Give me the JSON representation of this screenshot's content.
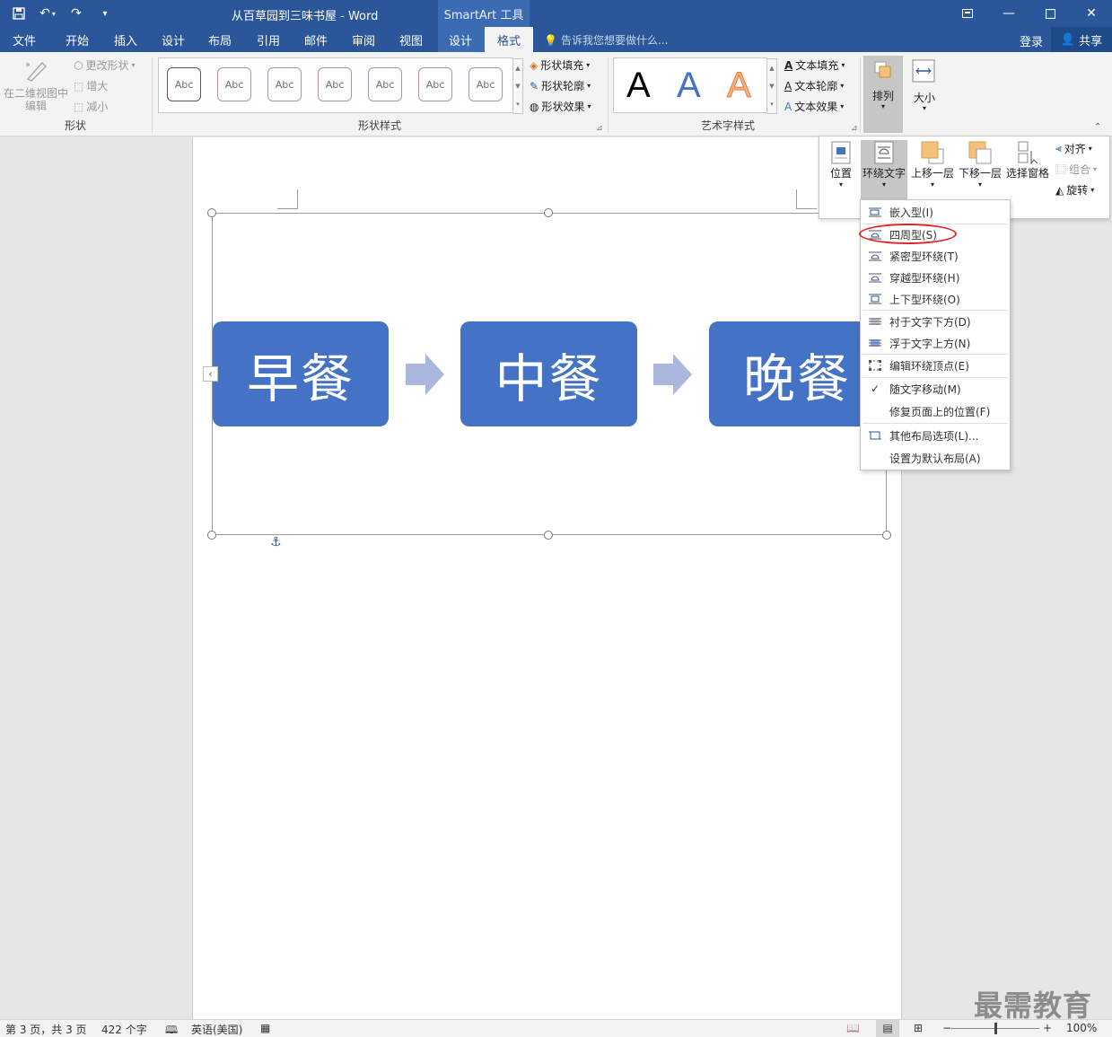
{
  "window": {
    "title": "从百草园到三味书屋 - Word",
    "context_tab_group": "SmartArt 工具"
  },
  "tabs": [
    "文件",
    "开始",
    "插入",
    "设计",
    "布局",
    "引用",
    "邮件",
    "审阅",
    "视图",
    "设计",
    "格式"
  ],
  "active_tab": "格式",
  "tell_me_placeholder": "告诉我您想要做什么...",
  "login_label": "登录",
  "share_label": "共享",
  "ribbon": {
    "shapes_group": {
      "edit_in_2d": "在二维视图中编辑",
      "change_shape": "更改形状",
      "larger": "增大",
      "smaller": "减小",
      "label": "形状"
    },
    "shape_styles_group": {
      "gallery_items": [
        "Abc",
        "Abc",
        "Abc",
        "Abc",
        "Abc",
        "Abc",
        "Abc"
      ],
      "shape_fill": "形状填充",
      "shape_outline": "形状轮廓",
      "shape_effects": "形状效果",
      "label": "形状样式"
    },
    "wordart_group": {
      "letters": [
        "A",
        "A",
        "A"
      ],
      "text_fill": "文本填充",
      "text_outline": "文本轮廓",
      "text_effects": "文本效果",
      "label": "艺术字样式"
    },
    "arrange_label": "排列",
    "size_label": "大小"
  },
  "arrange_panel": {
    "position": "位置",
    "wrap_text": "环绕文字",
    "bring_forward": "上移一层",
    "send_backward": "下移一层",
    "selection_pane": "选择窗格",
    "align": "对齐",
    "group": "组合",
    "rotate": "旋转"
  },
  "wrap_menu": {
    "items": [
      "嵌入型(I)",
      "四周型(S)",
      "紧密型环绕(T)",
      "穿越型环绕(H)",
      "上下型环绕(O)",
      "衬于文字下方(D)",
      "浮于文字上方(N)",
      "编辑环绕顶点(E)",
      "随文字移动(M)",
      "修复页面上的位置(F)",
      "其他布局选项(L)...",
      "设置为默认布局(A)"
    ],
    "highlighted": "四周型(S)",
    "checked": "随文字移动(M)"
  },
  "smartart": {
    "boxes": [
      "早餐",
      "中餐",
      "晚餐"
    ],
    "box_color": "#4472c4",
    "arrow_color": "#a9b8dc"
  },
  "status": {
    "page": "第 3 页，共 3 页",
    "words": "422 个字",
    "language": "英语(美国)",
    "zoom": "100%"
  },
  "watermark": "最需教育"
}
